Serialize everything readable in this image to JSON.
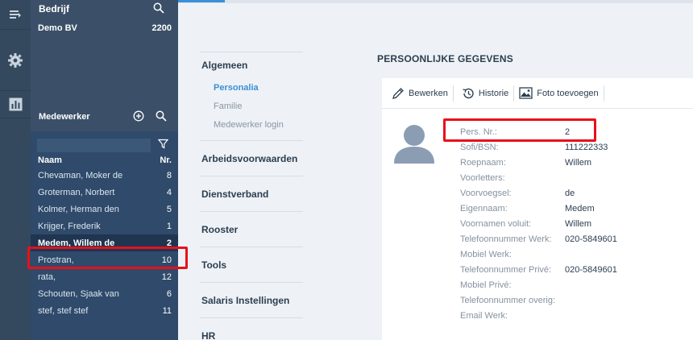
{
  "rail": {
    "icons": [
      "list-icon",
      "gear-icon",
      "chart-icon"
    ]
  },
  "company": {
    "title": "Bedrijf",
    "name": "Demo BV",
    "number": "2200"
  },
  "employees": {
    "title": "Medewerker",
    "columns": {
      "name": "Naam",
      "nr": "Nr."
    },
    "rows": [
      {
        "name": "Chevaman, Moker de",
        "nr": "8"
      },
      {
        "name": "Groterman, Norbert",
        "nr": "4"
      },
      {
        "name": "Kolmer, Herman den",
        "nr": "5"
      },
      {
        "name": "Krijger, Frederik",
        "nr": "1"
      },
      {
        "name": "Medem, Willem de",
        "nr": "2"
      },
      {
        "name": "Prostran,",
        "nr": "10"
      },
      {
        "name": "rata,",
        "nr": "12"
      },
      {
        "name": "Schouten, Sjaak van",
        "nr": "6"
      },
      {
        "name": "stef, stef stef",
        "nr": "11"
      }
    ]
  },
  "menu": {
    "algemeen": "Algemeen",
    "sub": [
      "Personalia",
      "Familie",
      "Medewerker login"
    ],
    "sections": [
      "Arbeidsvoorwaarden",
      "Dienstverband",
      "Rooster",
      "Tools",
      "Salaris Instellingen",
      "HR"
    ]
  },
  "main": {
    "title": "PERSOONLIJKE GEGEVENS",
    "toolbar": {
      "edit": "Bewerken",
      "history": "Historie",
      "photo": "Foto toevoegen"
    },
    "fields": [
      {
        "label": "Pers. Nr.:",
        "value": "2"
      },
      {
        "label": "Sofi/BSN:",
        "value": "111222333"
      },
      {
        "label": "Roepnaam:",
        "value": "Willem"
      },
      {
        "label": "Voorletters:",
        "value": ""
      },
      {
        "label": "Voorvoegsel:",
        "value": "de"
      },
      {
        "label": "Eigennaam:",
        "value": "Medem"
      },
      {
        "label": "Voornamen voluit:",
        "value": "Willem"
      },
      {
        "label": "Telefoonnummer Werk:",
        "value": "020-5849601"
      },
      {
        "label": "Mobiel Werk:",
        "value": ""
      },
      {
        "label": "Telefoonnummer Privé:",
        "value": "020-5849601"
      },
      {
        "label": "Mobiel Privé:",
        "value": ""
      },
      {
        "label": "Telefoonnummer overig:",
        "value": ""
      },
      {
        "label": "Email Werk:",
        "value": ""
      }
    ]
  },
  "colors": {
    "highlight": "#e8101a",
    "accent": "#3a8fd8",
    "panel": "#3b5068"
  }
}
